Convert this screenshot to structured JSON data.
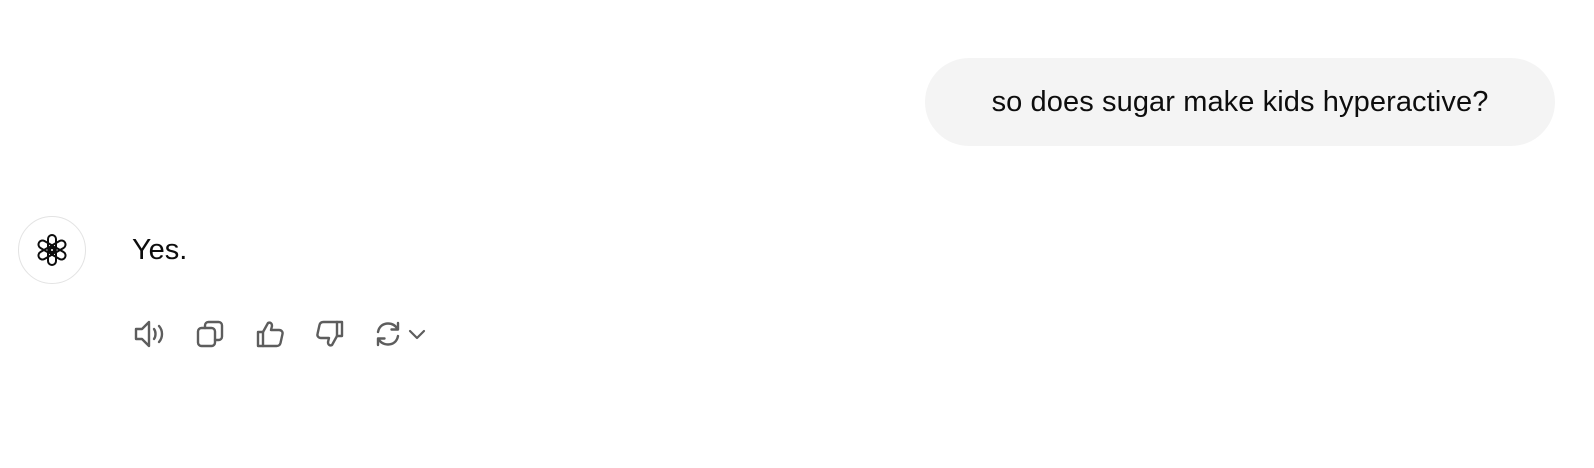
{
  "conversation": {
    "user_message": "so does sugar make kids hyperactive?",
    "assistant_message": "Yes."
  },
  "assistant": {
    "avatar_icon": "openai-logo-icon"
  },
  "actions": {
    "read_aloud_icon": "speaker-icon",
    "copy_icon": "copy-icon",
    "good_response_icon": "thumbs-up-icon",
    "bad_response_icon": "thumbs-down-icon",
    "regenerate_icon": "refresh-icon",
    "regenerate_menu_icon": "chevron-down-icon"
  },
  "colors": {
    "bubble_background": "#f4f4f4",
    "text": "#0d0d0d",
    "icon": "#5d5d5d",
    "avatar_border": "#e3e3e3"
  }
}
